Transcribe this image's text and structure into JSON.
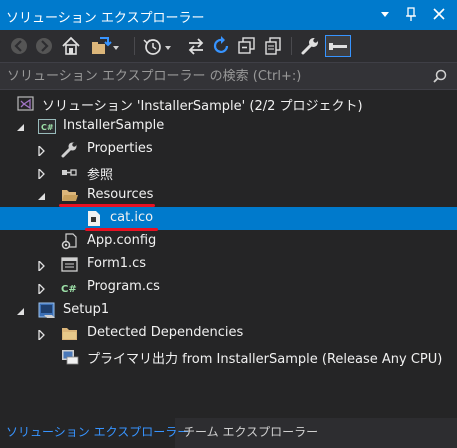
{
  "window": {
    "title": "ソリューション エクスプローラー"
  },
  "search": {
    "placeholder": "ソリューション エクスプローラー の検索 (Ctrl+:)"
  },
  "toolbar": {
    "icons": [
      "back-icon",
      "forward-icon",
      "home-icon",
      "sync-view-icon",
      "pending-changes-icon",
      "refresh-icon",
      "collapse-all-icon",
      "show-all-files-icon",
      "properties-icon",
      "preview-icon"
    ]
  },
  "tree": {
    "solution": "ソリューション 'InstallerSample' (2/2 プロジェクト)",
    "project": "InstallerSample",
    "properties": "Properties",
    "references": "参照",
    "resources": "Resources",
    "cat_ico": "cat.ico",
    "app_config": "App.config",
    "form1": "Form1.cs",
    "program": "Program.cs",
    "setup": "Setup1",
    "detected": "Detected Dependencies",
    "primary_output": "プライマリ出力 from InstallerSample (Release Any CPU)"
  },
  "tabs": {
    "solution_explorer": "ソリューション エクスプローラー",
    "team_explorer": "チーム エクスプローラー"
  },
  "colors": {
    "accent": "#007acc",
    "background": "#252526",
    "annotation": "#e81123"
  }
}
